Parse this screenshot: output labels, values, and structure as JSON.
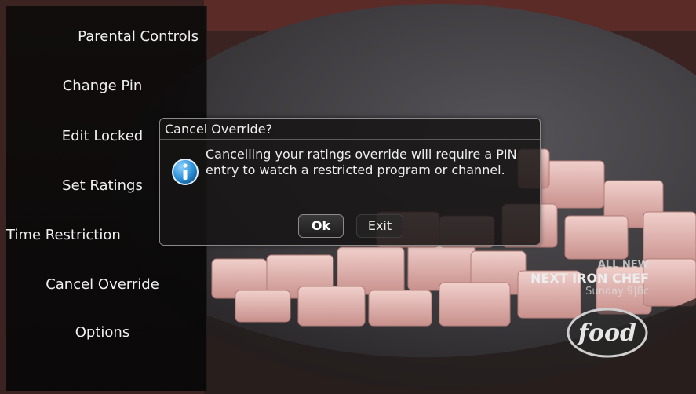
{
  "sidebar": {
    "header": "Parental Controls",
    "items": [
      {
        "label": "Change Pin"
      },
      {
        "label": "Edit Locked"
      },
      {
        "label": "Set Ratings"
      },
      {
        "label": "Time Restriction"
      },
      {
        "label": "Cancel Override"
      },
      {
        "label": "Options"
      }
    ]
  },
  "dialog": {
    "title": "Cancel Override?",
    "message": "Cancelling your ratings override will require a PIN entry to watch a restricted program or channel.",
    "ok_label": "Ok",
    "exit_label": "Exit",
    "icon": "info-icon"
  },
  "promo": {
    "line1": "ALL NEW",
    "line2": "NEXT IRON CHEF",
    "line3": "Sunday 9|8c",
    "channel_logo": "food"
  },
  "colors": {
    "sidebar_bg": "#0e0c0c",
    "dialog_bg": "#161414",
    "text": "#f0f0f0",
    "info_icon": "#2a8fd6"
  }
}
